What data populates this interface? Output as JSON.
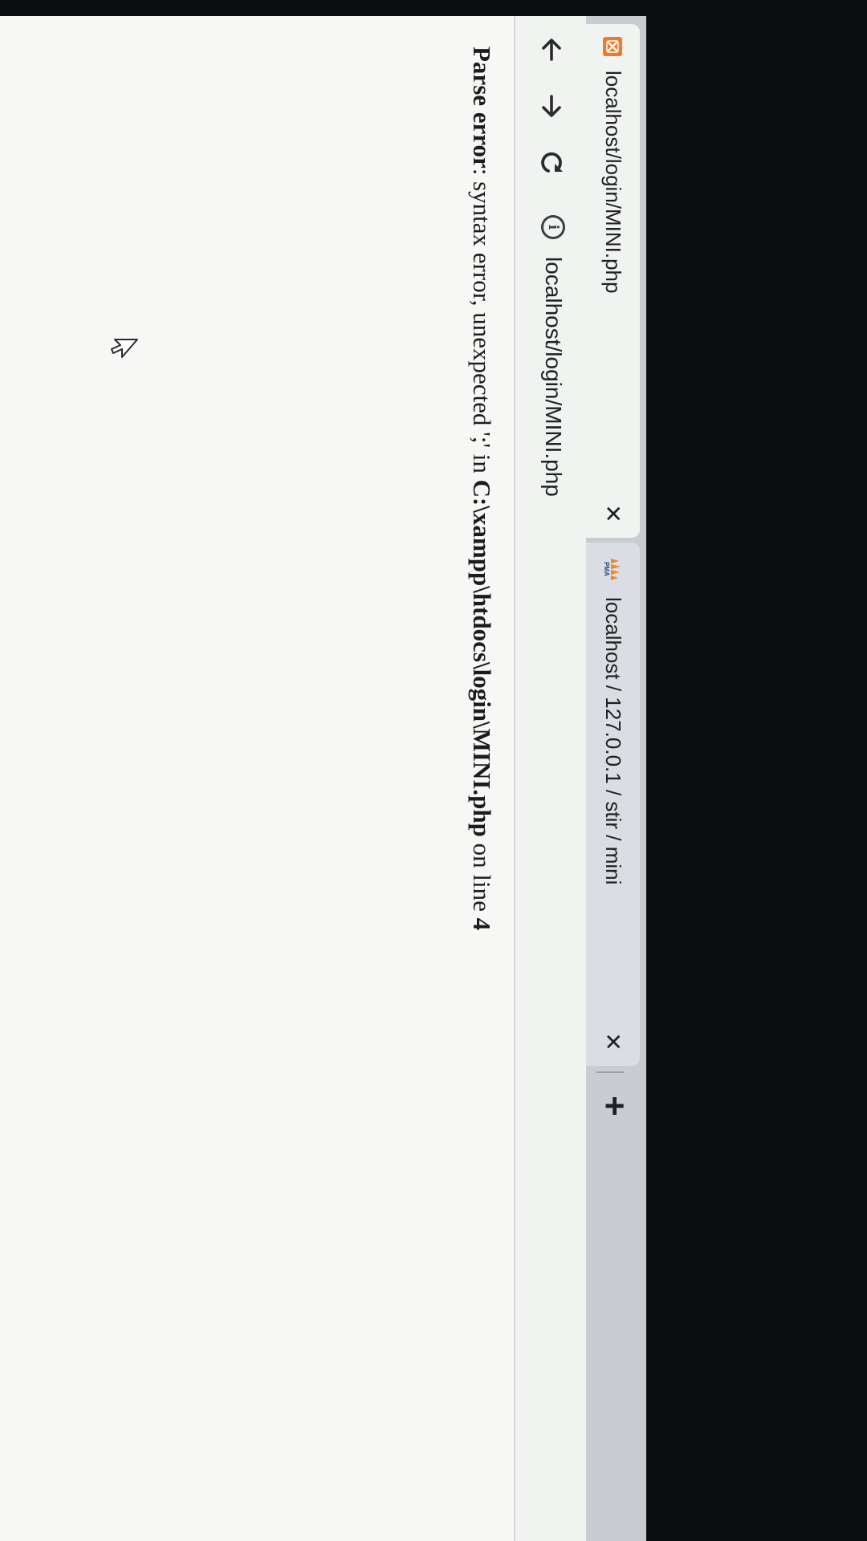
{
  "tabs": [
    {
      "title": "localhost/login/MINI.php",
      "favicon": "xampp-icon",
      "close_label": "✕",
      "active": true
    },
    {
      "title": "localhost / 127.0.0.1 / stir / mini",
      "favicon": "phpmyadmin-icon",
      "favicon_text": "PMA",
      "close_label": "✕",
      "active": false
    }
  ],
  "new_tab_label": "+",
  "toolbar": {
    "back_icon": "arrow-left-icon",
    "forward_icon": "arrow-right-icon",
    "reload_icon": "reload-icon",
    "site_info_icon": "info-icon",
    "url": "localhost/login/MINI.php"
  },
  "page": {
    "error_label": "Parse error",
    "error_message": ": syntax error, unexpected ';' in ",
    "error_file": "C:\\xampp\\htdocs\\login\\MINI.php",
    "error_on_line": " on line ",
    "error_line_number": "4"
  },
  "colors": {
    "xampp_orange": "#f07a2a",
    "pma_orange": "#e8892a",
    "tab_strip": "#c9ccd3",
    "toolbar": "#f1f3f1",
    "page_background": "#f7f8f5",
    "monitor_bezel": "#0b0c10"
  }
}
